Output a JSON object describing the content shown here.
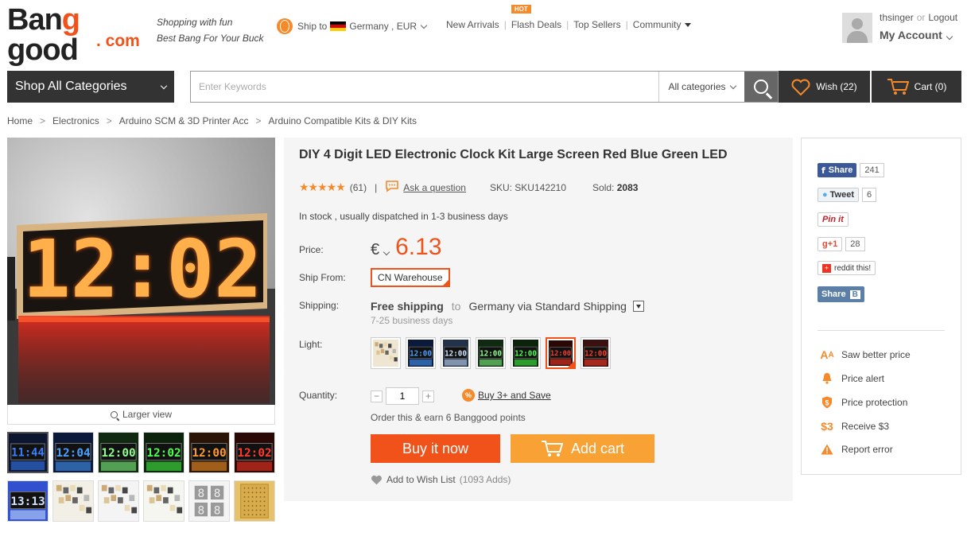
{
  "header": {
    "logo_line1_a": "Ban",
    "logo_line1_b": "g",
    "logo_line1_c": " good",
    "logo_line2": ". com",
    "slogan_1": "Shopping with fun",
    "slogan_2": "Best Bang For Your Buck",
    "ship_to_label": "Ship to",
    "ship_to_value": "Germany , EUR",
    "nav": [
      {
        "label": "New Arrivals"
      },
      {
        "label": "Flash Deals",
        "badge": "HOT"
      },
      {
        "label": "Top Sellers"
      },
      {
        "label": "Community"
      }
    ],
    "account": {
      "username": "thsinger",
      "or": "or",
      "logout": "Logout",
      "my_account": "My Account"
    }
  },
  "searchbar": {
    "shop_all": "Shop All Categories",
    "placeholder": "Enter Keywords",
    "category": "All categories",
    "wish": "Wish (22)",
    "cart": "Cart (0)"
  },
  "breadcrumb": [
    "Home",
    "Electronics",
    "Arduino SCM & 3D Printer Acc",
    "Arduino Compatible Kits & DIY Kits"
  ],
  "gallery": {
    "main_display": "12:02",
    "larger_view": "Larger view",
    "thumbs": [
      {
        "kind": "clock",
        "color": "#3a7fff",
        "bg": "#0d1630",
        "text": "11:44",
        "active": true
      },
      {
        "kind": "clock",
        "color": "#4aa0ff",
        "bg": "#0b1a3a",
        "text": "12:04"
      },
      {
        "kind": "clock",
        "color": "#8cff8c",
        "bg": "#0f2a10",
        "text": "12:00"
      },
      {
        "kind": "clock",
        "color": "#4cff4c",
        "bg": "#0b230b",
        "text": "12:02"
      },
      {
        "kind": "clock",
        "color": "#ff9a2a",
        "bg": "#2a1405",
        "text": "12:00"
      },
      {
        "kind": "clock",
        "color": "#ff3a2a",
        "bg": "#2a0805",
        "text": "12:02"
      },
      {
        "kind": "clock",
        "color": "#cfe3ff",
        "bg": "#3050d0",
        "text": "13:13"
      },
      {
        "kind": "parts",
        "bg": "#f2efe6"
      },
      {
        "kind": "parts",
        "bg": "#f4f4f4"
      },
      {
        "kind": "parts",
        "bg": "#f6f6f0"
      },
      {
        "kind": "digits",
        "bg": "#f4f4f4"
      },
      {
        "kind": "board",
        "bg": "#e8c26a"
      }
    ]
  },
  "product": {
    "title": "DIY 4 Digit LED Electronic Clock Kit Large Screen Red Blue Green LED",
    "stars": "★★★★★",
    "reviews": "(61)",
    "ask": "Ask a question",
    "sku": "SKU: SKU142210",
    "sold_label": "Sold:",
    "sold_value": "2083",
    "stock": "In stock , usually dispatched in 1-3 business days",
    "price_label": "Price:",
    "currency": "€",
    "price": "6.13",
    "ship_from_label": "Ship From:",
    "warehouse": "CN Warehouse",
    "shipping_label": "Shipping:",
    "shipping_free": "Free shipping",
    "shipping_to": "to",
    "shipping_dest": "Germany via Standard Shipping",
    "shipping_days": "7-25 business days",
    "light_label": "Light:",
    "swatches": [
      {
        "kind": "parts",
        "bg": "#efe6d2"
      },
      {
        "kind": "clock",
        "color": "#4aa0ff",
        "bg": "#0b1a3a"
      },
      {
        "kind": "clock",
        "color": "#cfe3ff",
        "bg": "#22324a"
      },
      {
        "kind": "clock",
        "color": "#8cff8c",
        "bg": "#0f2a10"
      },
      {
        "kind": "clock",
        "color": "#4cff4c",
        "bg": "#0b230b"
      },
      {
        "kind": "clock",
        "color": "#ff3a2a",
        "bg": "#2a0805",
        "selected": true
      },
      {
        "kind": "clock",
        "color": "#ff3a2a",
        "bg": "#3a1010"
      }
    ],
    "quantity_label": "Quantity:",
    "quantity": "1",
    "buy3": "Buy 3+ and Save",
    "points": "Order this & earn 6 Banggood points",
    "buy_now": "Buy it now",
    "add_cart": "Add cart",
    "add_wish": "Add to Wish List",
    "wish_adds": "(1093 Adds)"
  },
  "side": {
    "fb_share": "Share",
    "fb_count": "241",
    "tweet": "Tweet",
    "tweet_count": "6",
    "pin": "Pin it",
    "gplus": "g+1",
    "gplus_count": "28",
    "reddit": "reddit this!",
    "vk_share": "Share",
    "links": [
      {
        "icon": "AA",
        "label": "Saw better price"
      },
      {
        "icon": "bell",
        "label": "Price alert"
      },
      {
        "icon": "$",
        "label": "Price protection"
      },
      {
        "icon": "$3",
        "label": "Receive $3"
      },
      {
        "icon": "!",
        "label": "Report error"
      }
    ]
  },
  "colors": {
    "accent": "#f1521a",
    "accent_light": "#f8a135",
    "dark_bar": "#333333"
  }
}
